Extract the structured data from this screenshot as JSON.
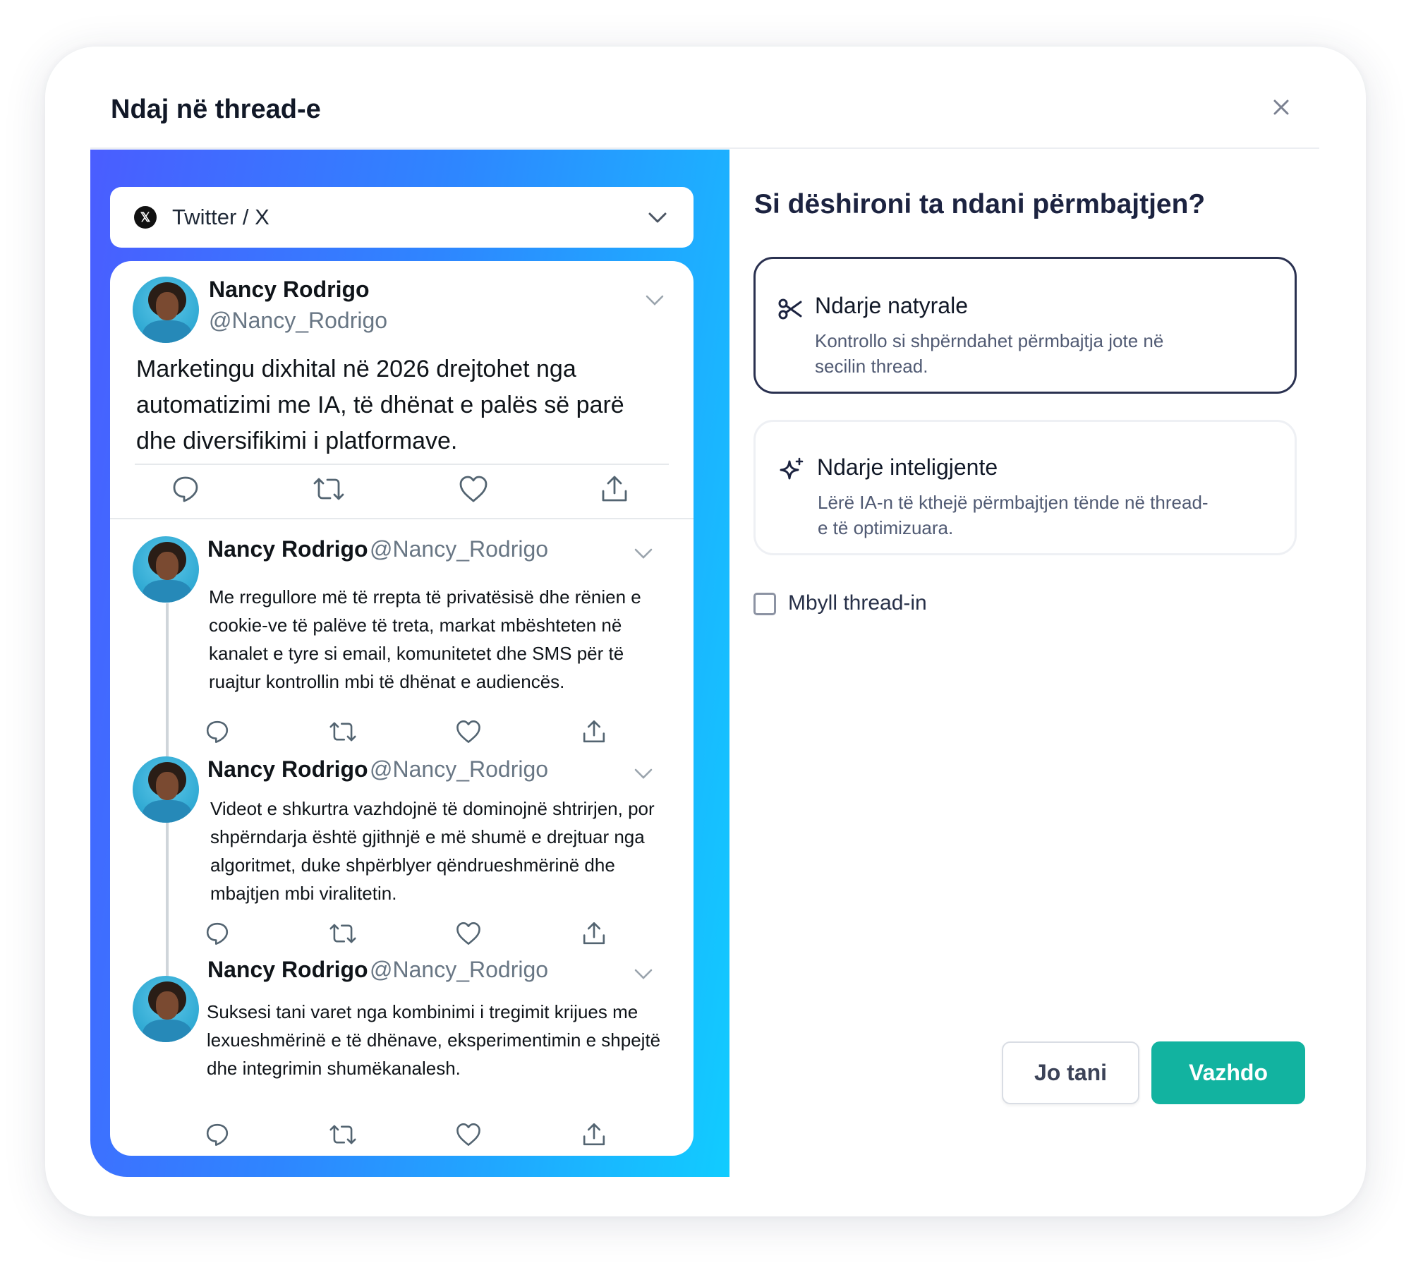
{
  "modal": {
    "title": "Ndaj në thread-e"
  },
  "preview": {
    "platform": {
      "icon": "x-logo-icon",
      "label": "Twitter / X"
    },
    "tweets": [
      {
        "name": "Nancy Rodrigo",
        "handle": "@Nancy_Rodrigo",
        "text": "Marketingu dixhital në 2026 drejtohet nga automatizimi me IA, të dhënat e palës së parë dhe diversifikimi i platformave."
      },
      {
        "name": "Nancy Rodrigo",
        "handle": "@Nancy_Rodrigo",
        "text": "Me rregullore më të rrepta të privatësisë dhe rënien e cookie-ve të palëve të treta, markat mbështeten në kanalet e tyre si email, komunitetet dhe SMS për të ruajtur kontrollin mbi të dhënat e audiencës."
      },
      {
        "name": "Nancy Rodrigo",
        "handle": "@Nancy_Rodrigo",
        "text": "Videot e shkurtra vazhdojnë të dominojnë shtrirjen, por shpërndarja është gjithnjë e më shumë e drejtuar nga algoritmet, duke shpërblyer qëndrueshmërinë dhe mbajtjen mbi viralitetin."
      },
      {
        "name": "Nancy Rodrigo",
        "handle": "@Nancy_Rodrigo",
        "text": "Suksesi tani varet nga kombinimi i tregimit krijues me lexueshmërinë e të dhënave, eksperimentimin e shpejtë dhe integrimin shumëkanalesh."
      }
    ]
  },
  "split": {
    "question": "Si dëshironi ta ndani përmbajtjen?",
    "options": [
      {
        "icon": "scissors-icon",
        "title": "Ndarje natyrale",
        "description": "Kontrollo si shpërndahet përmbajtja jote në secilin thread.",
        "selected": true
      },
      {
        "icon": "sparkles-icon",
        "title": "Ndarje inteligjente",
        "description": "Lërë IA-n të kthejë përmbajtjen tënde në thread-e të optimizuara.",
        "selected": false
      }
    ],
    "close_thread": {
      "label": "Mbyll thread-in",
      "checked": false
    }
  },
  "actions": {
    "secondary_label": "Jo tani",
    "primary_label": "Vazhdo"
  },
  "colors": {
    "primary": "#12b3a0",
    "gradient_start": "#4a5dff",
    "gradient_end": "#11ccff",
    "selected_border": "#2a3150"
  }
}
